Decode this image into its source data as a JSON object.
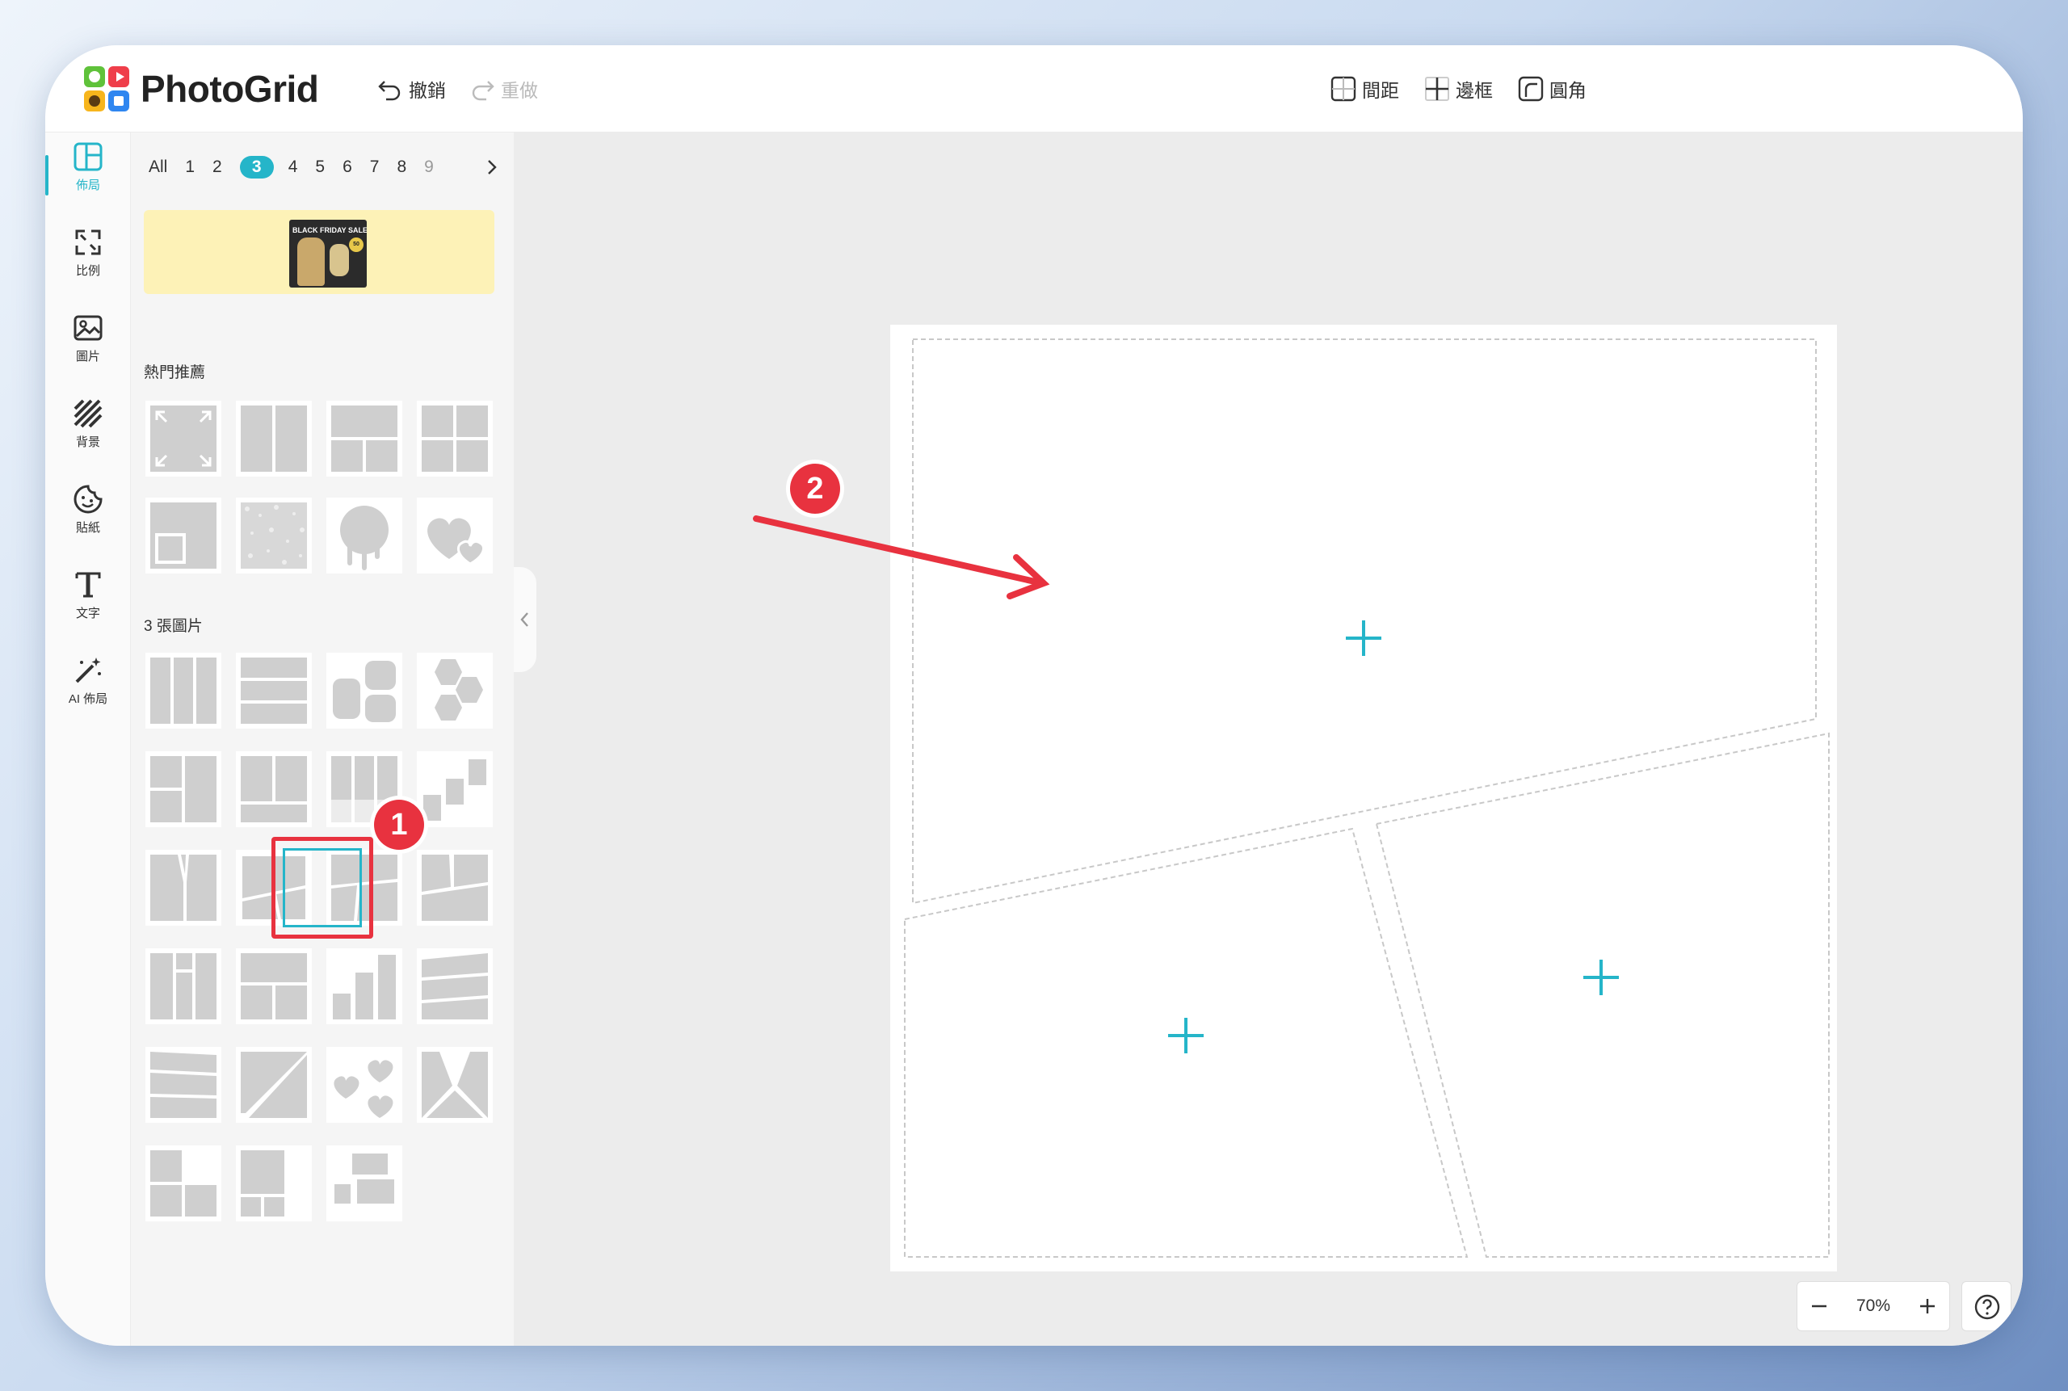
{
  "app": {
    "brand": "PhotoGrid"
  },
  "toolbar": {
    "undo_label": "撤銷",
    "redo_label": "重做",
    "spacing_label": "間距",
    "border_label": "邊框",
    "corner_label": "圓角"
  },
  "rail": {
    "items": [
      {
        "label": "佈局",
        "icon": "layout-icon",
        "active": true
      },
      {
        "label": "比例",
        "icon": "ratio-icon"
      },
      {
        "label": "圖片",
        "icon": "image-icon"
      },
      {
        "label": "背景",
        "icon": "background-icon"
      },
      {
        "label": "貼紙",
        "icon": "sticker-icon"
      },
      {
        "label": "文字",
        "icon": "text-icon"
      },
      {
        "label": "AI 佈局",
        "icon": "magic-wand-icon"
      }
    ]
  },
  "panel": {
    "count_tabs": [
      "All",
      "1",
      "2",
      "3",
      "4",
      "5",
      "6",
      "7",
      "8",
      "9"
    ],
    "active_tab": "3",
    "banner_text": "BLACK FRIDAY SALE",
    "banner_badge": "50",
    "section_hot": "熱門推薦",
    "section_three": "3 張圖片"
  },
  "annotations": {
    "step1": "1",
    "step2": "2",
    "marker_color": "#e8323f"
  },
  "zoom": {
    "value": "70%"
  },
  "colors": {
    "accent": "#25b5c9",
    "placeholder_gray": "#cfcfcf"
  }
}
